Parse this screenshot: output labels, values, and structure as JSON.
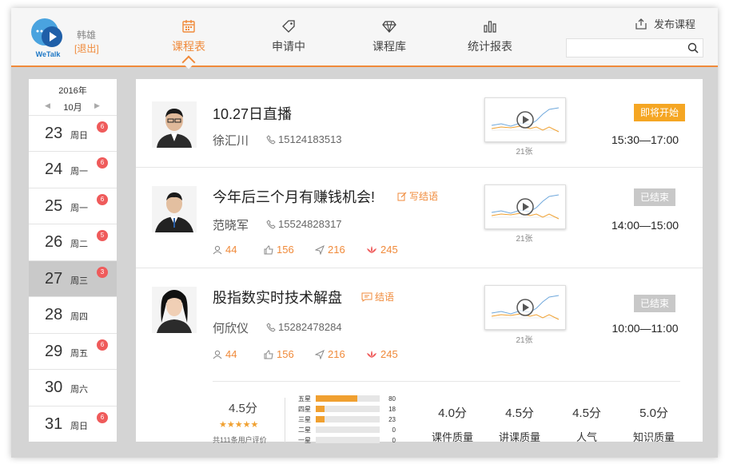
{
  "header": {
    "logo_text": "WeTalk",
    "user_name": "韩雄",
    "logout_label": "[退出]",
    "tabs": [
      {
        "label": "课程表",
        "icon": "calendar-icon",
        "active": true
      },
      {
        "label": "申请中",
        "icon": "tag-icon",
        "active": false
      },
      {
        "label": "课程库",
        "icon": "diamond-icon",
        "active": false
      },
      {
        "label": "统计报表",
        "icon": "bar-chart-icon",
        "active": false
      }
    ],
    "publish_label": "发布课程",
    "search_placeholder": ""
  },
  "calendar": {
    "year": "2016年",
    "month": "10月",
    "days": [
      {
        "num": "23",
        "weekday": "周日",
        "badge": "6"
      },
      {
        "num": "24",
        "weekday": "周一",
        "badge": "6"
      },
      {
        "num": "25",
        "weekday": "周一",
        "badge": "6"
      },
      {
        "num": "26",
        "weekday": "周二",
        "badge": "5"
      },
      {
        "num": "27",
        "weekday": "周三",
        "badge": "3",
        "selected": true
      },
      {
        "num": "28",
        "weekday": "周四",
        "badge": ""
      },
      {
        "num": "29",
        "weekday": "周五",
        "badge": "6"
      },
      {
        "num": "30",
        "weekday": "周六",
        "badge": ""
      },
      {
        "num": "31",
        "weekday": "周日",
        "badge": "6"
      }
    ]
  },
  "courses": [
    {
      "title": "10.27日直播",
      "teacher": "徐汇川",
      "phone": "15124183513",
      "thumb_count": "21张",
      "status": "即将开始",
      "time": "15:30—17:00"
    },
    {
      "title": "今年后三个月有赚钱机会!",
      "note_label": "写结语",
      "teacher": "范晓军",
      "phone": "15524828317",
      "stats": {
        "students": "44",
        "likes": "156",
        "shares": "216",
        "gifts": "245"
      },
      "thumb_count": "21张",
      "status": "已结束",
      "time": "14:00—15:00"
    },
    {
      "title": "股指数实时技术解盘",
      "note_label": "结语",
      "teacher": "何欣仪",
      "phone": "15282478284",
      "stats": {
        "students": "44",
        "likes": "156",
        "shares": "216",
        "gifts": "245"
      },
      "thumb_count": "21张",
      "status": "已结束",
      "time": "10:00—11:00"
    }
  ],
  "rating": {
    "score": "4.5分",
    "stars": "★★★★★",
    "count_text": "共111条用户评价",
    "bars": [
      {
        "label": "五星",
        "value": "80",
        "fraction": 0.65
      },
      {
        "label": "四星",
        "value": "18",
        "fraction": 0.14
      },
      {
        "label": "三星",
        "value": "23",
        "fraction": 0.14
      },
      {
        "label": "二星",
        "value": "0",
        "fraction": 0
      },
      {
        "label": "一星",
        "value": "0",
        "fraction": 0
      }
    ],
    "metrics": [
      {
        "value": "4.0分",
        "label": "课件质量"
      },
      {
        "value": "4.5分",
        "label": "讲课质量"
      },
      {
        "value": "4.5分",
        "label": "人气"
      },
      {
        "value": "5.0分",
        "label": "知识质量"
      }
    ]
  },
  "colors": {
    "accent": "#f08a3a",
    "status_upcoming": "#f5a623",
    "status_ended": "#c8c8c8",
    "badge": "#ef5b5b"
  }
}
